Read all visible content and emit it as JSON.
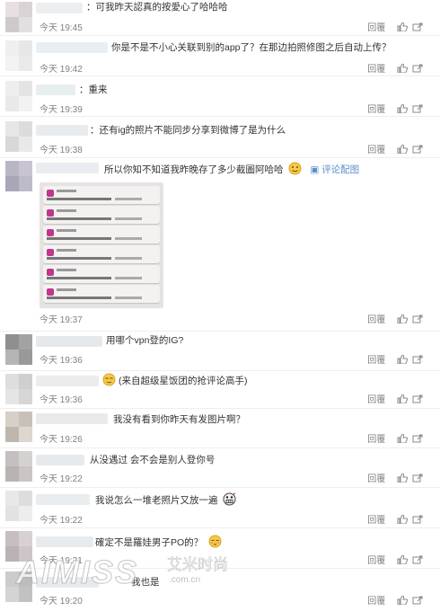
{
  "actions": {
    "reply": "回覆",
    "like_icon": "thumbs-up-icon"
  },
  "view_image_label": "评论配图",
  "watermark": {
    "main": "AIMISS",
    "cn": "艾米时尚",
    "domain": ".com.cn"
  },
  "comments": [
    {
      "text": "：可我昨天認真的按愛心了哈哈哈",
      "time": "今天 19:45"
    },
    {
      "text": "你是不是不小心关联到别的app了？在那边拍照修图之后自动上传？",
      "time": "今天 19:42"
    },
    {
      "text": "：重来",
      "time": "今天 19:39"
    },
    {
      "text": "：还有ig的照片不能同步分享到微博了是为什么",
      "time": "今天 19:38"
    },
    {
      "text": "所以你知不知道我昨晚存了多少截圖阿哈哈",
      "time": "今天 19:37",
      "emoji": "smiling-face-icon"
    },
    {
      "text": "用哪个vpn登的IG?",
      "time": "今天 19:36"
    },
    {
      "text": "(来自超级星饭团的抢评论高手)",
      "time": "今天 19:36",
      "emoji": "smiling-face-icon"
    },
    {
      "text": "我没有看到你昨天有发图片啊？",
      "time": "今天 19:26"
    },
    {
      "text": "从没遇过 会不会是别人登你号",
      "time": "今天 19:22"
    },
    {
      "text": "我说怎么一堆老照片又放一遍",
      "time": "今天 19:22",
      "emoji": "grimacing-face-icon"
    },
    {
      "text": "確定不是羅娃男子PO的？",
      "time": "今天 19:21",
      "emoji": "blushing-face-icon"
    },
    {
      "text": "我也是",
      "time": "今天 19:20"
    }
  ]
}
